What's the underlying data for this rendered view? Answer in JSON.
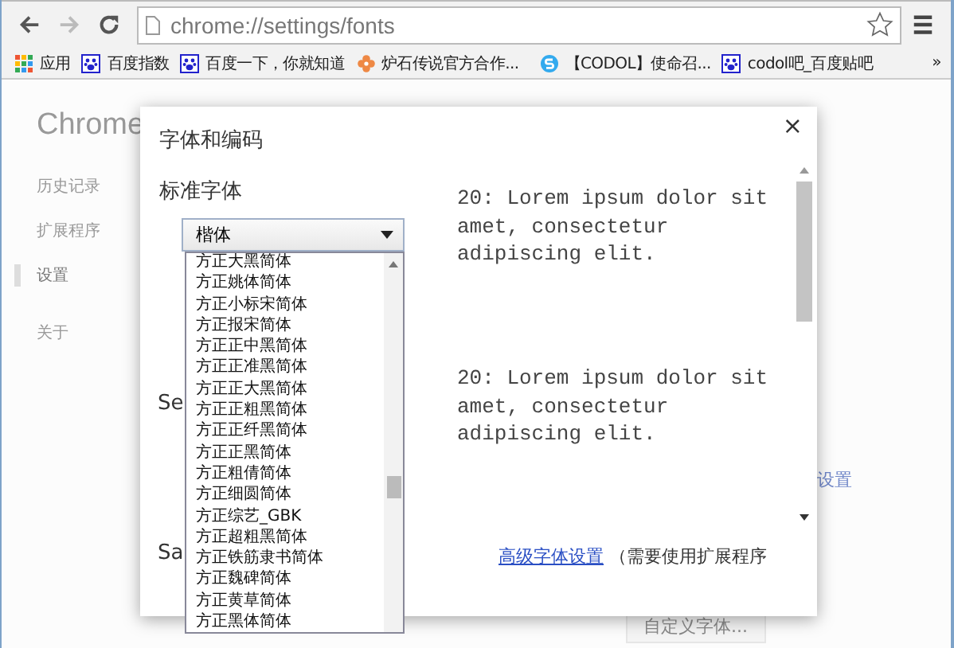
{
  "browser": {
    "address": "chrome://settings/fonts",
    "bookmarks": [
      {
        "kind": "apps",
        "label": "应用"
      },
      {
        "kind": "paw",
        "label": "百度指数"
      },
      {
        "kind": "paw",
        "label": "百度一下，你就知道"
      },
      {
        "kind": "flower",
        "label": "炉石传说官方合作..."
      },
      {
        "kind": "swirl",
        "label": "【CODOL】使命召..."
      },
      {
        "kind": "paw",
        "label": "codol吧_百度贴吧"
      }
    ],
    "overflow": "»"
  },
  "page": {
    "brand": "Chrome",
    "sidebar": [
      {
        "label": "历史记录",
        "selected": false
      },
      {
        "label": "扩展程序",
        "selected": false
      },
      {
        "label": "设置",
        "selected": true
      },
      {
        "label": "关于",
        "selected": false
      }
    ],
    "side_link": "设置",
    "custom_fonts_button": "自定义字体..."
  },
  "dialog": {
    "title": "字体和编码",
    "close": "×",
    "heading": "标准字体",
    "select": {
      "value": "楷体",
      "expanded": true
    },
    "options": [
      "方正大黑简体",
      "方正姚体简体",
      "方正小标宋简体",
      "方正报宋简体",
      "方正正中黑简体",
      "方正正准黑简体",
      "方正正大黑简体",
      "方正正粗黑简体",
      "方正正纤黑简体",
      "方正正黑简体",
      "方正粗倩简体",
      "方正细圆简体",
      "方正综艺_GBK",
      "方正超粗黑简体",
      "方正铁筋隶书简体",
      "方正魏碑简体",
      "方正黄草简体",
      "方正黑体简体"
    ],
    "labels": [
      "Se",
      "Sa"
    ],
    "samples": [
      "20: Lorem ipsum dolor sit amet, consectetur adipiscing elit.",
      "20: Lorem ipsum dolor sit amet, consectetur adipiscing elit."
    ],
    "link": "高级字体设置",
    "note": "（需要使用扩展程序"
  }
}
